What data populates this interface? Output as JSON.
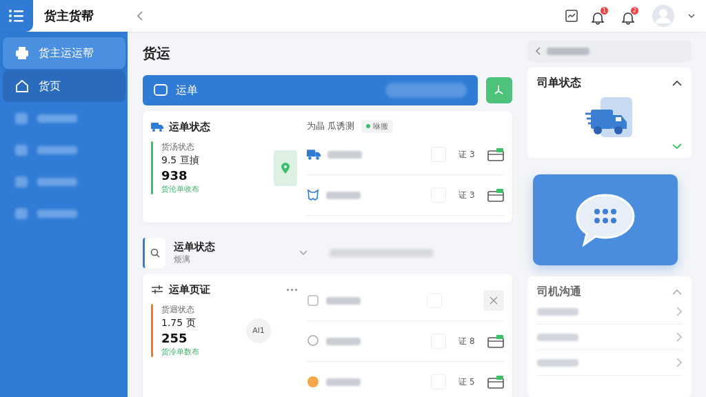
{
  "app": {
    "title": "货主货帮"
  },
  "header": {
    "badges": [
      "1",
      "2"
    ]
  },
  "sidebar": {
    "items": [
      {
        "label": "货主运运帮",
        "selected": true
      },
      {
        "label": "货页",
        "selected": false
      }
    ]
  },
  "page_title": "货运",
  "waybill_bar": {
    "label": "运单"
  },
  "cards": [
    {
      "title": "运单状态",
      "stat_label": "货汤状态",
      "stat_value": "9.5 亘揁",
      "stat_number": "938",
      "stat_note": "货沦单收布",
      "color": "#3cc06a",
      "list_title": "为晶 瓜诱测",
      "tag": "咻搬",
      "rows": [
        {
          "count": "证 3",
          "checked": false
        },
        {
          "count": "证 3",
          "checked": false
        }
      ]
    },
    {
      "title": "运单页证",
      "stat_label": "货迴状态",
      "stat_value": "1.75 页",
      "stat_number": "255",
      "stat_note": "货泠单数布",
      "color": "#f0782c",
      "avatar": "Al1",
      "top_row": {
        "checked": false
      },
      "rows": [
        {
          "count": "证 8",
          "checked": false
        },
        {
          "count": "证 5",
          "checked": false
        }
      ]
    }
  ],
  "collapsed": {
    "title": "运单状态",
    "subtitle": "烦漓"
  },
  "driver_status": {
    "title": "司单状态"
  },
  "driver_chat": {
    "title": "司机沟通"
  }
}
